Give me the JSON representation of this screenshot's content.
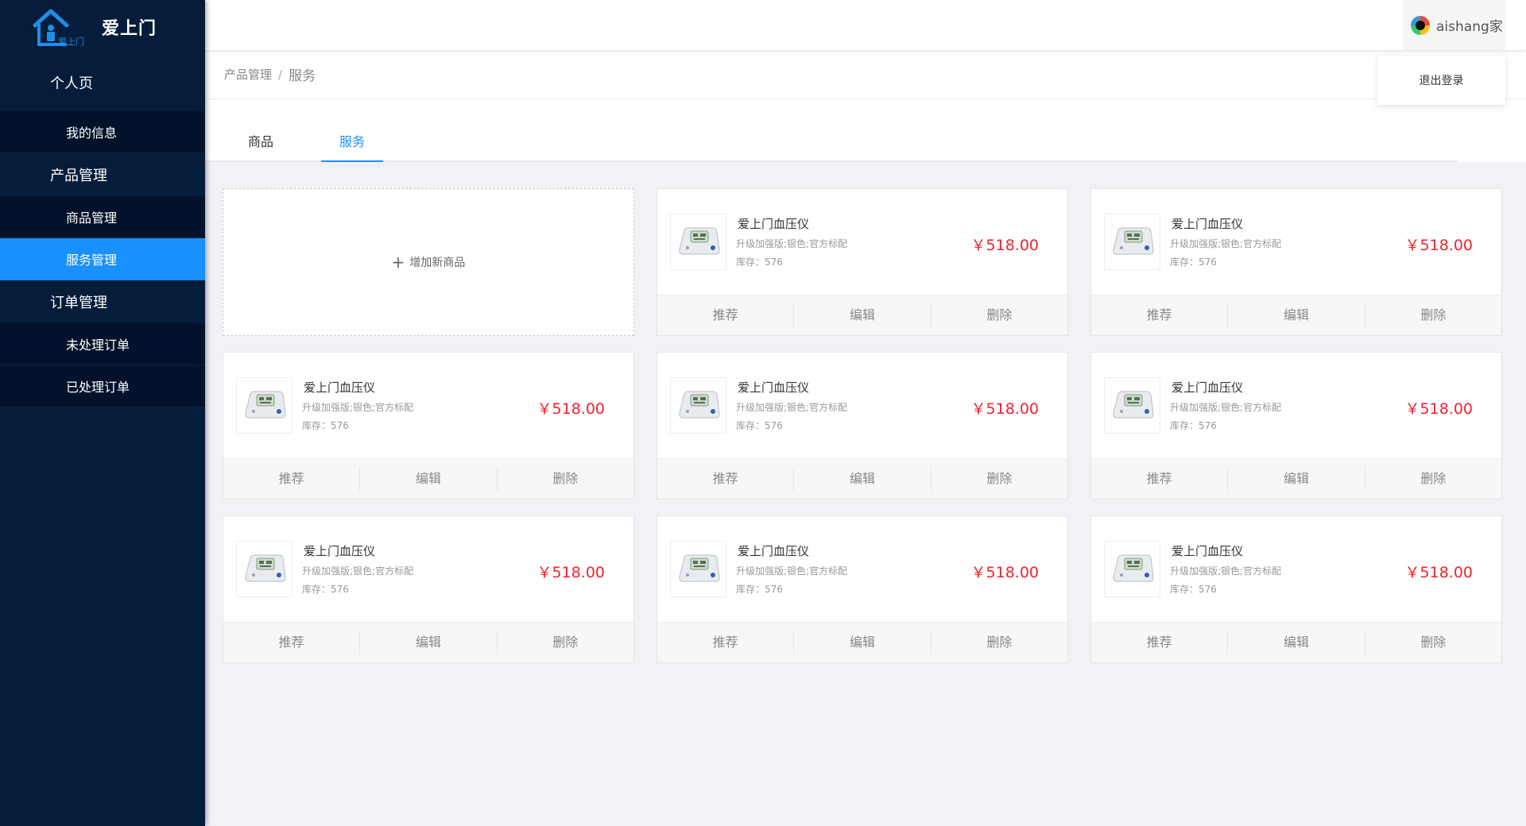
{
  "brand": {
    "name": "爱上门",
    "logo_text": "爱上门"
  },
  "sidebar": {
    "groups": [
      {
        "label": "个人页",
        "items": [
          {
            "label": "我的信息"
          }
        ]
      },
      {
        "label": "产品管理",
        "items": [
          {
            "label": "商品管理"
          },
          {
            "label": "服务管理",
            "active": true
          }
        ]
      },
      {
        "label": "订单管理",
        "items": [
          {
            "label": "未处理订单"
          },
          {
            "label": "已处理订单"
          }
        ]
      }
    ]
  },
  "header": {
    "user_name": "aishang家",
    "dropdown_logout": "退出登录"
  },
  "breadcrumb": {
    "parent": "产品管理",
    "separator": "/",
    "current": "服务"
  },
  "tabs": [
    {
      "label": "商品"
    },
    {
      "label": "服务",
      "active": true
    }
  ],
  "add_card": {
    "label": "增加新商品",
    "icon": "plus-icon"
  },
  "products": [
    {
      "name": "爱上门血压仪",
      "desc": "升级加强版;银色;官方标配",
      "stock": "库存：576",
      "price": "￥518.00",
      "actions": [
        "推荐",
        "编辑",
        "删除"
      ]
    },
    {
      "name": "爱上门血压仪",
      "desc": "升级加强版;银色;官方标配",
      "stock": "库存：576",
      "price": "￥518.00",
      "actions": [
        "推荐",
        "编辑",
        "删除"
      ]
    },
    {
      "name": "爱上门血压仪",
      "desc": "升级加强版;银色;官方标配",
      "stock": "库存：576",
      "price": "￥518.00",
      "actions": [
        "推荐",
        "编辑",
        "删除"
      ]
    },
    {
      "name": "爱上门血压仪",
      "desc": "升级加强版;银色;官方标配",
      "stock": "库存：576",
      "price": "￥518.00",
      "actions": [
        "推荐",
        "编辑",
        "删除"
      ]
    },
    {
      "name": "爱上门血压仪",
      "desc": "升级加强版;银色;官方标配",
      "stock": "库存：576",
      "price": "￥518.00",
      "actions": [
        "推荐",
        "编辑",
        "删除"
      ]
    },
    {
      "name": "爱上门血压仪",
      "desc": "升级加强版;银色;官方标配",
      "stock": "库存：576",
      "price": "￥518.00",
      "actions": [
        "推荐",
        "编辑",
        "删除"
      ]
    },
    {
      "name": "爱上门血压仪",
      "desc": "升级加强版;银色;官方标配",
      "stock": "库存：576",
      "price": "￥518.00",
      "actions": [
        "推荐",
        "编辑",
        "删除"
      ]
    },
    {
      "name": "爱上门血压仪",
      "desc": "升级加强版;银色;官方标配",
      "stock": "库存：576",
      "price": "￥518.00",
      "actions": [
        "推荐",
        "编辑",
        "删除"
      ]
    }
  ],
  "colors": {
    "sidebar_bg": "#051c3a",
    "active": "#1890ff",
    "price": "#f5222d"
  }
}
